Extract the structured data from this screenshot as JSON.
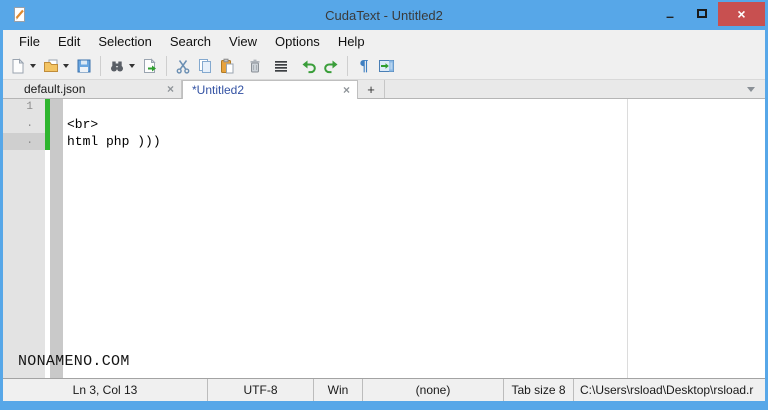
{
  "window": {
    "title": "CudaText - Untitled2",
    "minimize_glyph": "–",
    "close_glyph": "×",
    "accent_color": "#57a7e8",
    "close_color": "#c85050"
  },
  "menu": {
    "items": [
      "File",
      "Edit",
      "Selection",
      "Search",
      "View",
      "Options",
      "Help"
    ]
  },
  "toolbar": {
    "icons": [
      "new-file",
      "open-file",
      "save-file",
      "find",
      "goto-file",
      "cut",
      "copy",
      "paste",
      "delete",
      "select-all",
      "undo",
      "redo",
      "show-unprinted-chars",
      "focus-panel"
    ],
    "pilcrow_glyph": "¶"
  },
  "tabs": {
    "items": [
      {
        "label": "default.json",
        "active": false
      },
      {
        "label": "*Untitled2",
        "active": true
      }
    ],
    "close_glyph": "×",
    "add_label": "+"
  },
  "editor": {
    "lines": [
      {
        "gutter": "1",
        "text": ""
      },
      {
        "gutter": ".",
        "text": "<br>"
      },
      {
        "gutter": ".",
        "text": "html php )))",
        "current": true
      }
    ],
    "watermark": "NONAMENO.COM"
  },
  "statusbar": {
    "caret": "Ln 3, Col 13",
    "encoding": "UTF-8",
    "line_ends": "Win",
    "lexer": "(none)",
    "tab_size": "Tab size 8",
    "file_path": "C:\\Users\\rsload\\Desktop\\rsload.r"
  }
}
